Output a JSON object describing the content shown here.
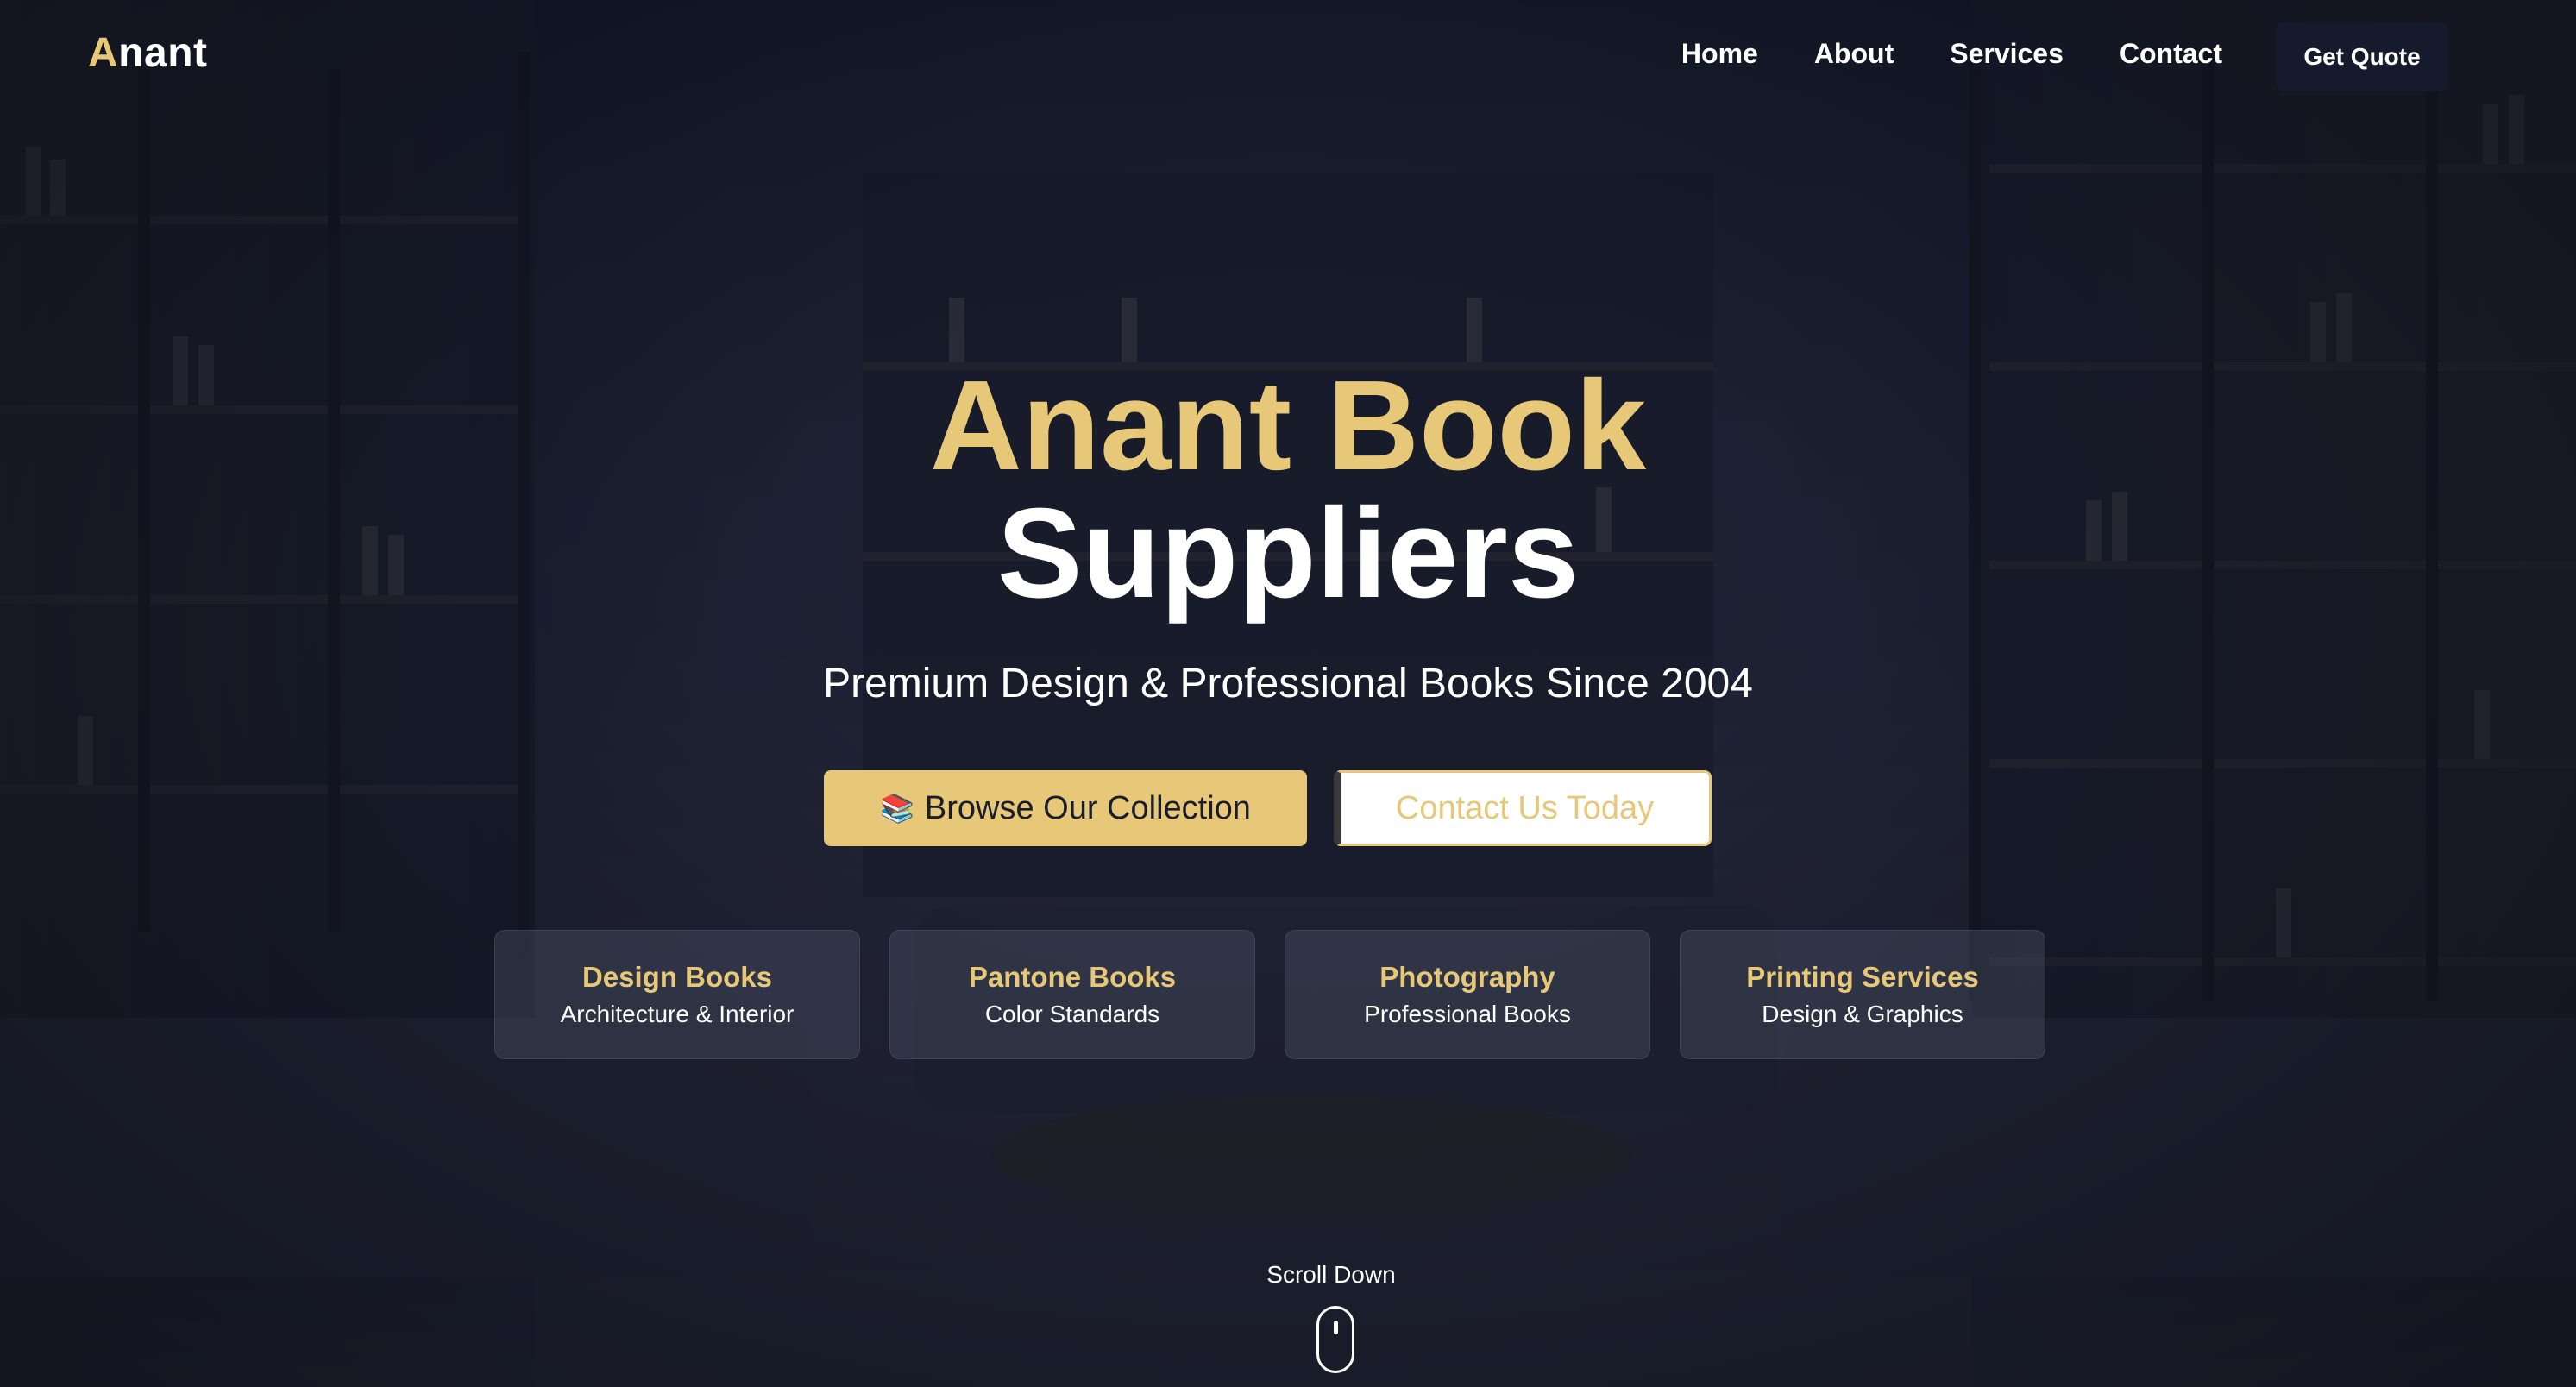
{
  "brand": {
    "logo_first": "A",
    "logo_rest": "nant"
  },
  "nav": {
    "links": [
      "Home",
      "About",
      "Services",
      "Contact"
    ],
    "quote_label": "Get Quote"
  },
  "hero": {
    "title_line1": "Anant Book",
    "title_line2": "Suppliers",
    "subtitle": "Premium Design & Professional Books Since 2004",
    "primary_emoji": "📚",
    "primary_label": "Browse Our Collection",
    "secondary_label": "Contact Us Today"
  },
  "categories": [
    {
      "title": "Design Books",
      "sub": "Architecture & Interior"
    },
    {
      "title": "Pantone Books",
      "sub": "Color Standards"
    },
    {
      "title": "Photography",
      "sub": "Professional Books"
    },
    {
      "title": "Printing Services",
      "sub": "Design & Graphics"
    }
  ],
  "scroll": {
    "label": "Scroll Down"
  },
  "colors": {
    "accent": "#e6c878",
    "background": "#1b1f30",
    "text": "#ffffff"
  }
}
